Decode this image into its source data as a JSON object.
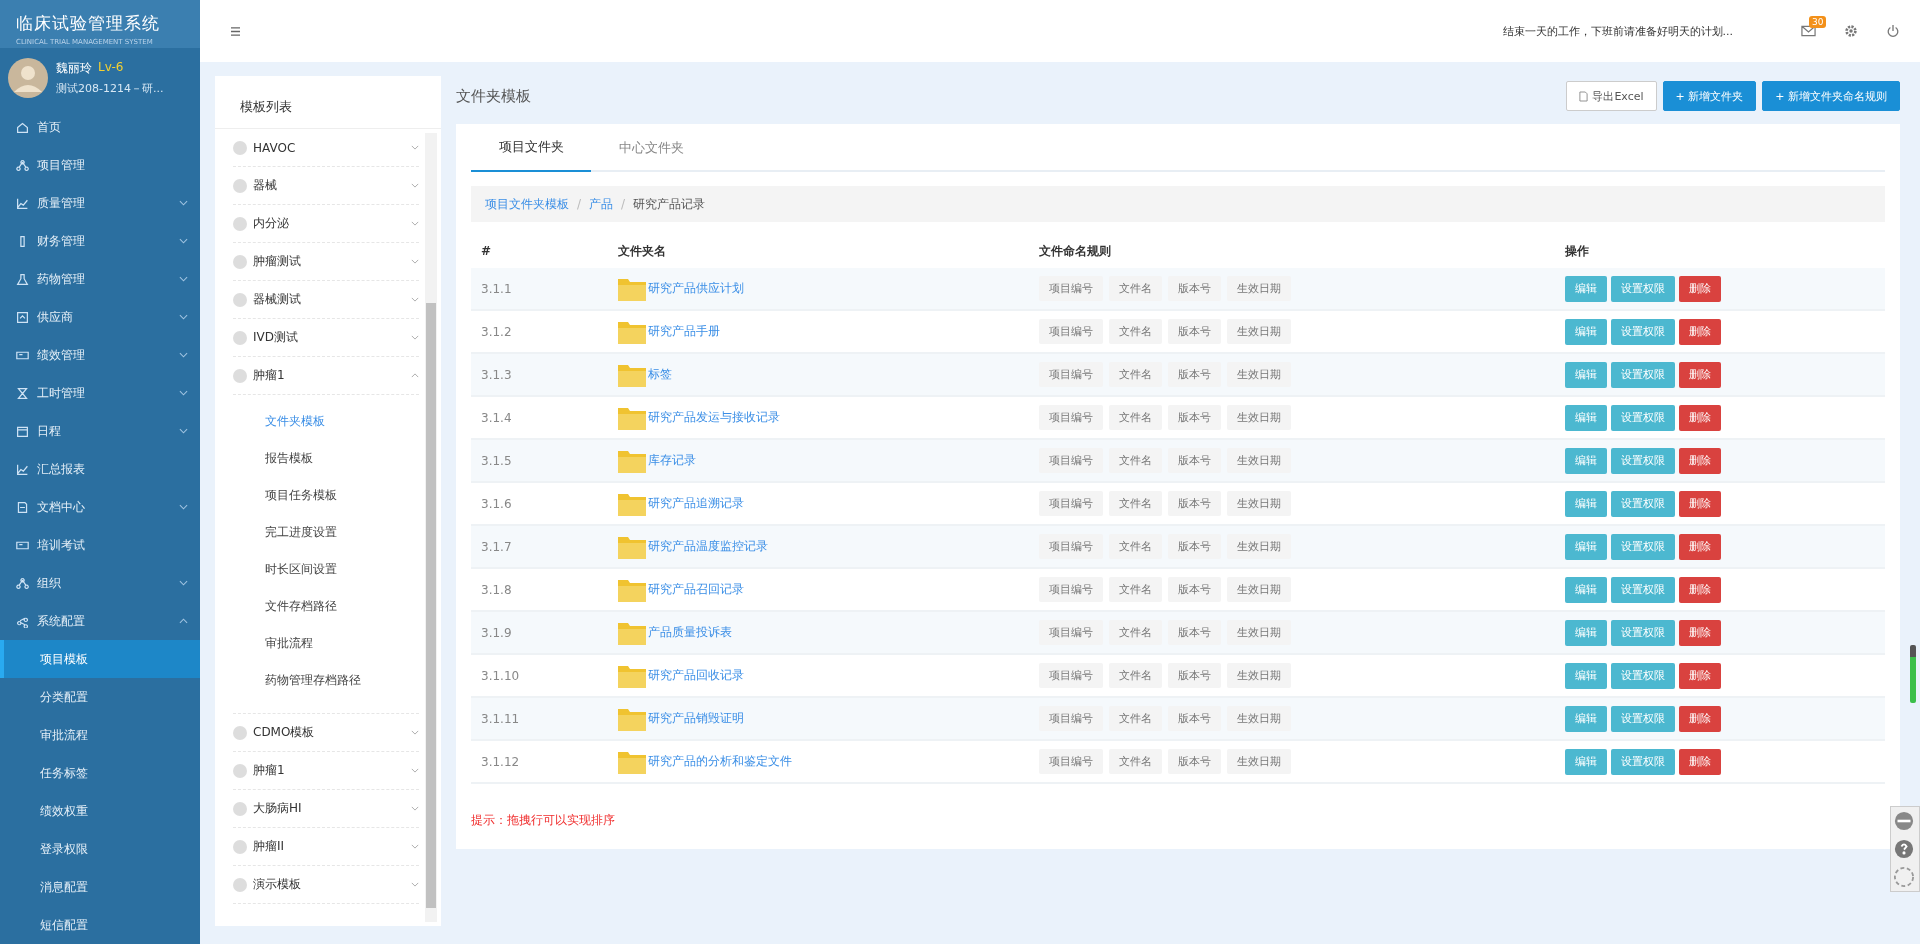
{
  "app": {
    "title": "临床试验管理系统",
    "subtitle": "CLINICAL TRIAL MANAGEMENT SYSTEM"
  },
  "user": {
    "name": "魏丽玲",
    "level": "Lv-6",
    "org": "测试208-1214－研..."
  },
  "nav": [
    {
      "label": "首页",
      "kind": "link"
    },
    {
      "label": "项目管理",
      "kind": "link"
    },
    {
      "label": "质量管理",
      "kind": "group",
      "expanded": false
    },
    {
      "label": "财务管理",
      "kind": "group",
      "expanded": false
    },
    {
      "label": "药物管理",
      "kind": "group",
      "expanded": false
    },
    {
      "label": "供应商",
      "kind": "group",
      "expanded": false
    },
    {
      "label": "绩效管理",
      "kind": "group",
      "expanded": false
    },
    {
      "label": "工时管理",
      "kind": "group",
      "expanded": false
    },
    {
      "label": "日程",
      "kind": "group",
      "expanded": false
    },
    {
      "label": "汇总报表",
      "kind": "link"
    },
    {
      "label": "文档中心",
      "kind": "group",
      "expanded": false
    },
    {
      "label": "培训考试",
      "kind": "link"
    },
    {
      "label": "组织",
      "kind": "group",
      "expanded": false
    },
    {
      "label": "系统配置",
      "kind": "group",
      "expanded": true,
      "children": [
        {
          "label": "项目模板",
          "selected": true
        },
        {
          "label": "分类配置",
          "selected": false
        },
        {
          "label": "审批流程",
          "selected": false
        },
        {
          "label": "任务标签",
          "selected": false
        },
        {
          "label": "绩效权重",
          "selected": false
        },
        {
          "label": "登录权限",
          "selected": false
        },
        {
          "label": "消息配置",
          "selected": false
        },
        {
          "label": "短信配置",
          "selected": false
        }
      ]
    }
  ],
  "header": {
    "notice": "结束一天的工作，下班前请准备好明天的计划...",
    "mail_badge": "30"
  },
  "templates": {
    "title": "模板列表",
    "items": [
      {
        "label": "HAVOC",
        "expanded": false
      },
      {
        "label": "器械",
        "expanded": false
      },
      {
        "label": "内分泌",
        "expanded": false
      },
      {
        "label": "肿瘤测试",
        "expanded": false
      },
      {
        "label": "器械测试",
        "expanded": false
      },
      {
        "label": "IVD测试",
        "expanded": false
      },
      {
        "label": "肿瘤1",
        "expanded": true,
        "children": [
          {
            "label": "文件夹模板",
            "selected": true
          },
          {
            "label": "报告模板",
            "selected": false
          },
          {
            "label": "项目任务模板",
            "selected": false
          },
          {
            "label": "完工进度设置",
            "selected": false
          },
          {
            "label": "时长区间设置",
            "selected": false
          },
          {
            "label": "文件存档路径",
            "selected": false
          },
          {
            "label": "审批流程",
            "selected": false
          },
          {
            "label": "药物管理存档路径",
            "selected": false
          }
        ]
      },
      {
        "label": "CDMO模板",
        "expanded": false
      },
      {
        "label": "肿瘤1",
        "expanded": false
      },
      {
        "label": "大肠病HI",
        "expanded": false
      },
      {
        "label": "肿瘤II",
        "expanded": false
      },
      {
        "label": "演示模板",
        "expanded": false
      }
    ]
  },
  "page": {
    "title": "文件夹模板",
    "buttons": [
      {
        "label": "导出Excel",
        "kind": "outline"
      },
      {
        "label": "+ 新增文件夹",
        "kind": "primary"
      },
      {
        "label": "+ 新增文件夹命名规则",
        "kind": "primary"
      }
    ]
  },
  "tabs": [
    {
      "label": "项目文件夹",
      "selected": true
    },
    {
      "label": "中心文件夹",
      "selected": false
    }
  ],
  "breadcrumb": [
    {
      "label": "项目文件夹模板",
      "kind": "link"
    },
    {
      "separator": "/",
      "label": "产品",
      "kind": "link"
    },
    {
      "separator": "/",
      "label": "研究产品记录",
      "kind": "current"
    }
  ],
  "table": {
    "columns": [
      "#",
      "文件夹名",
      "文件命名规则",
      "操作"
    ],
    "rows": [
      {
        "index": "3.1.1",
        "name": "研究产品供应计划",
        "rules": [
          "项目编号",
          "文件名",
          "版本号",
          "生效日期"
        ],
        "actions": [
          {
            "label": "编辑",
            "kind": "info"
          },
          {
            "label": "设置权限",
            "kind": "info"
          },
          {
            "label": "删除",
            "kind": "danger"
          }
        ]
      },
      {
        "index": "3.1.2",
        "name": "研究产品手册",
        "rules": [
          "项目编号",
          "文件名",
          "版本号",
          "生效日期"
        ],
        "actions": [
          {
            "label": "编辑",
            "kind": "info"
          },
          {
            "label": "设置权限",
            "kind": "info"
          },
          {
            "label": "删除",
            "kind": "danger"
          }
        ]
      },
      {
        "index": "3.1.3",
        "name": "标签",
        "rules": [
          "项目编号",
          "文件名",
          "版本号",
          "生效日期"
        ],
        "actions": [
          {
            "label": "编辑",
            "kind": "info"
          },
          {
            "label": "设置权限",
            "kind": "info"
          },
          {
            "label": "删除",
            "kind": "danger"
          }
        ]
      },
      {
        "index": "3.1.4",
        "name": "研究产品发运与接收记录",
        "rules": [
          "项目编号",
          "文件名",
          "版本号",
          "生效日期"
        ],
        "actions": [
          {
            "label": "编辑",
            "kind": "info"
          },
          {
            "label": "设置权限",
            "kind": "info"
          },
          {
            "label": "删除",
            "kind": "danger"
          }
        ]
      },
      {
        "index": "3.1.5",
        "name": "库存记录",
        "rules": [
          "项目编号",
          "文件名",
          "版本号",
          "生效日期"
        ],
        "actions": [
          {
            "label": "编辑",
            "kind": "info"
          },
          {
            "label": "设置权限",
            "kind": "info"
          },
          {
            "label": "删除",
            "kind": "danger"
          }
        ]
      },
      {
        "index": "3.1.6",
        "name": "研究产品追溯记录",
        "rules": [
          "项目编号",
          "文件名",
          "版本号",
          "生效日期"
        ],
        "actions": [
          {
            "label": "编辑",
            "kind": "info"
          },
          {
            "label": "设置权限",
            "kind": "info"
          },
          {
            "label": "删除",
            "kind": "danger"
          }
        ]
      },
      {
        "index": "3.1.7",
        "name": "研究产品温度监控记录",
        "rules": [
          "项目编号",
          "文件名",
          "版本号",
          "生效日期"
        ],
        "actions": [
          {
            "label": "编辑",
            "kind": "info"
          },
          {
            "label": "设置权限",
            "kind": "info"
          },
          {
            "label": "删除",
            "kind": "danger"
          }
        ]
      },
      {
        "index": "3.1.8",
        "name": "研究产品召回记录",
        "rules": [
          "项目编号",
          "文件名",
          "版本号",
          "生效日期"
        ],
        "actions": [
          {
            "label": "编辑",
            "kind": "info"
          },
          {
            "label": "设置权限",
            "kind": "info"
          },
          {
            "label": "删除",
            "kind": "danger"
          }
        ]
      },
      {
        "index": "3.1.9",
        "name": "产品质量投诉表",
        "rules": [
          "项目编号",
          "文件名",
          "版本号",
          "生效日期"
        ],
        "actions": [
          {
            "label": "编辑",
            "kind": "info"
          },
          {
            "label": "设置权限",
            "kind": "info"
          },
          {
            "label": "删除",
            "kind": "danger"
          }
        ]
      },
      {
        "index": "3.1.10",
        "name": "研究产品回收记录",
        "rules": [
          "项目编号",
          "文件名",
          "版本号",
          "生效日期"
        ],
        "actions": [
          {
            "label": "编辑",
            "kind": "info"
          },
          {
            "label": "设置权限",
            "kind": "info"
          },
          {
            "label": "删除",
            "kind": "danger"
          }
        ]
      },
      {
        "index": "3.1.11",
        "name": "研究产品销毁证明",
        "rules": [
          "项目编号",
          "文件名",
          "版本号",
          "生效日期"
        ],
        "actions": [
          {
            "label": "编辑",
            "kind": "info"
          },
          {
            "label": "设置权限",
            "kind": "info"
          },
          {
            "label": "删除",
            "kind": "danger"
          }
        ]
      },
      {
        "index": "3.1.12",
        "name": "研究产品的分析和鉴定文件",
        "rules": [
          "项目编号",
          "文件名",
          "版本号",
          "生效日期"
        ],
        "actions": [
          {
            "label": "编辑",
            "kind": "info"
          },
          {
            "label": "设置权限",
            "kind": "info"
          },
          {
            "label": "删除",
            "kind": "danger"
          }
        ]
      }
    ]
  },
  "hint": "提示：拖拽行可以实现排序"
}
